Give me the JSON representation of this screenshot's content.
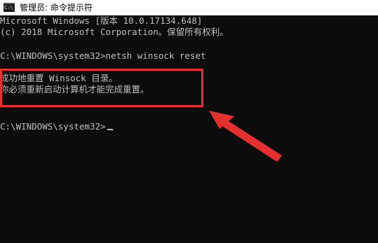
{
  "window": {
    "icon_glyph": "C:\\",
    "title": "管理员: 命令提示符"
  },
  "console": {
    "lines": [
      "Microsoft Windows [版本 10.0.17134.648]",
      "(c) 2018 Microsoft Corporation。保留所有权利。",
      "C:\\WINDOWS\\system32>netsh winsock reset",
      "成功地重置 Winsock 目录。",
      "你必须重新启动计算机才能完成重置。",
      "C:\\WINDOWS\\system32>"
    ]
  },
  "annotation": {
    "box_color": "#e63030",
    "arrow_color": "#e63030"
  },
  "colors": {
    "console_bg": "#0c0c0c",
    "console_text": "#c0c0c0",
    "titlebar_bg": "#ffffff"
  }
}
